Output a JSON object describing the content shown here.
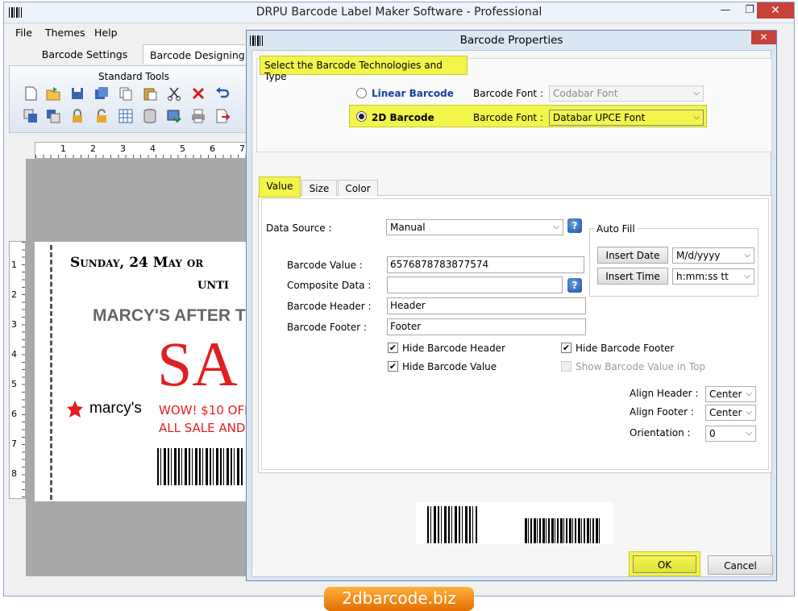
{
  "app": {
    "title": "DRPU Barcode Label Maker Software - Professional",
    "window_controls": {
      "minimize": "—",
      "restore": "❐",
      "close": "✕"
    }
  },
  "menu": [
    "File",
    "Themes",
    "Help"
  ],
  "tabs": [
    {
      "label": "Barcode Settings"
    },
    {
      "label": "Barcode Designing V"
    }
  ],
  "toolbar": {
    "group_label": "Standard Tools"
  },
  "ruler": {
    "horizontal": [
      "1",
      "2",
      "3",
      "4",
      "5",
      "6",
      "7"
    ],
    "vertical": [
      "1",
      "2",
      "3",
      "4",
      "5",
      "6",
      "7",
      "8"
    ]
  },
  "label_preview": {
    "line1": "Sunday, 24 May or",
    "line2": "unti",
    "line3": "MARCY'S AFTER T",
    "big": "SA",
    "brand": "marcy's",
    "offer1": "WOW! $10 OFF",
    "offer2": "ALL SALE AND"
  },
  "dialog": {
    "title": "Barcode Properties",
    "close": "✕",
    "section_title": "Select the Barcode Technologies and Type",
    "linear_label": "Linear Barcode",
    "linear_font_label": "Barcode Font :",
    "linear_font_value": "Codabar Font",
    "twod_label": "2D Barcode",
    "twod_font_label": "Barcode Font :",
    "twod_font_value": "Databar UPCE Font",
    "inner_tabs": [
      "Value",
      "Size",
      "Color"
    ],
    "data_source_label": "Data Source :",
    "data_source_value": "Manual",
    "barcode_value_label": "Barcode Value :",
    "barcode_value": "6576878783877574",
    "composite_label": "Composite Data :",
    "composite_value": "",
    "header_label": "Barcode Header :",
    "header_value": "Header",
    "footer_label": "Barcode Footer :",
    "footer_value": "Footer",
    "auto_fill_label": "Auto Fill",
    "insert_date": "Insert Date",
    "date_format": "M/d/yyyy",
    "insert_time": "Insert Time",
    "time_format": "h:mm:ss tt",
    "hide_header": "Hide Barcode Header",
    "hide_footer": "Hide Barcode Footer",
    "hide_value": "Hide Barcode Value",
    "show_top": "Show Barcode Value in Top",
    "align_header_label": "Align Header :",
    "align_header_value": "Center",
    "align_footer_label": "Align Footer :",
    "align_footer_value": "Center",
    "orientation_label": "Orientation :",
    "orientation_value": "0",
    "ok": "OK",
    "cancel": "Cancel"
  },
  "watermark": "2dbarcode.biz"
}
